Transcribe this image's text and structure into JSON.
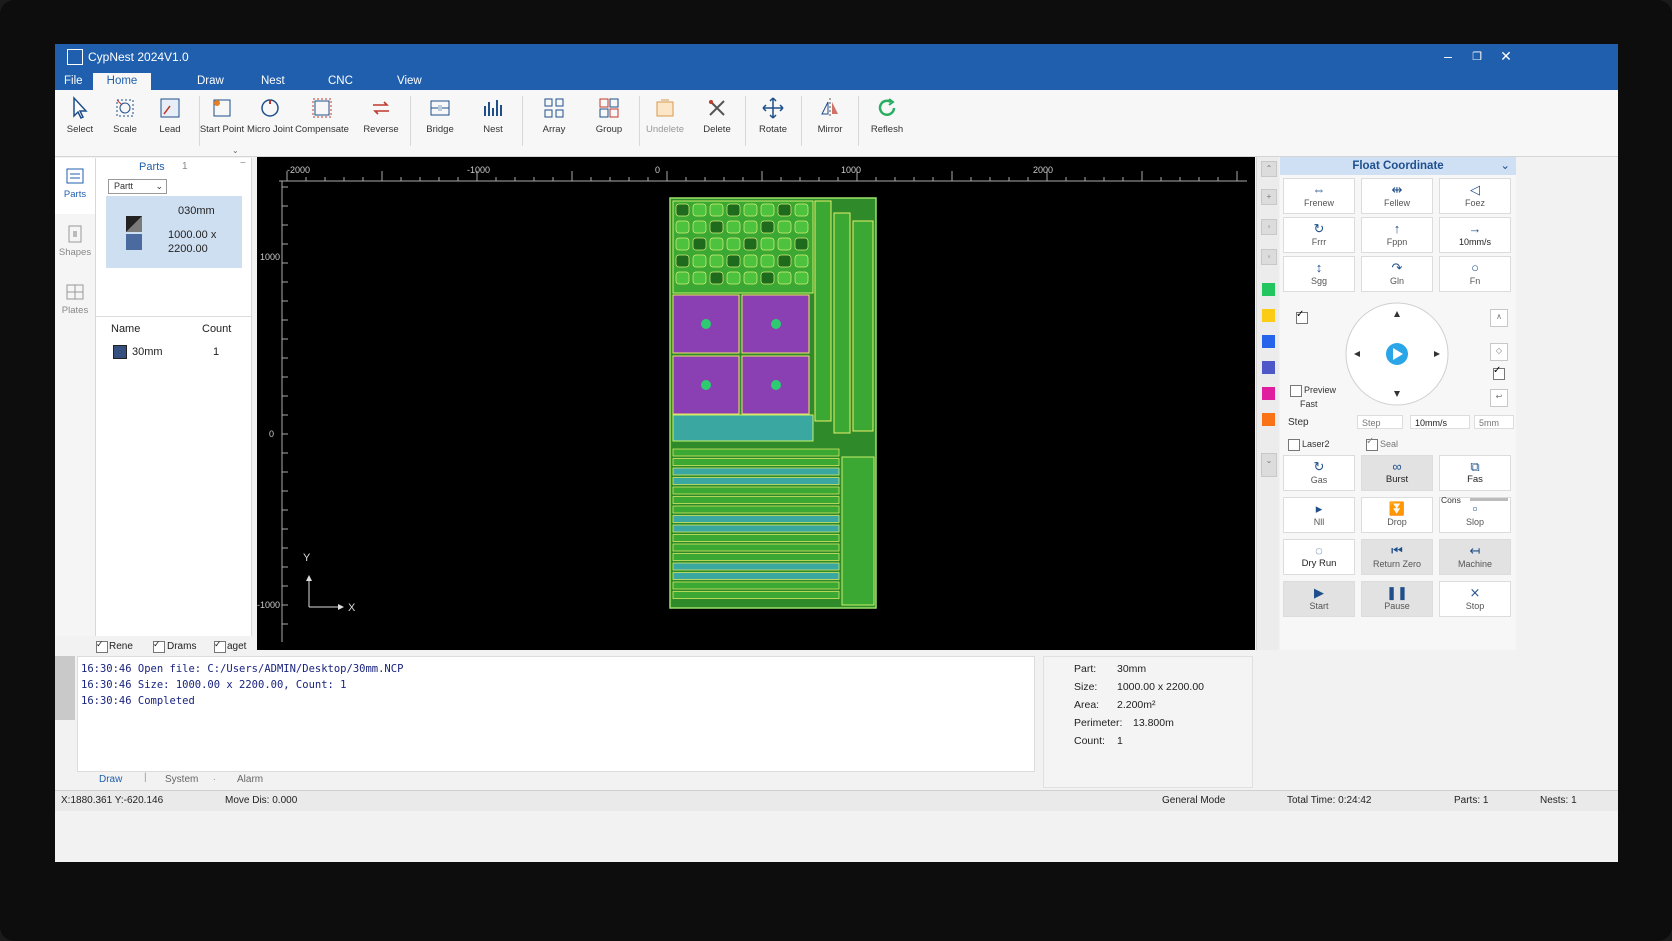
{
  "window": {
    "title": "CypNest 2024V1.0"
  },
  "menu": {
    "tabs": [
      "File",
      "Home",
      "Draw",
      "Nest",
      "CNC",
      "View"
    ],
    "active": "Home"
  },
  "ribbon": {
    "buttons": [
      {
        "label": "Select",
        "icon": "cursor-icon"
      },
      {
        "label": "Scale",
        "icon": "scale-icon"
      },
      {
        "label": "Lead",
        "icon": "lead-icon"
      },
      {
        "label": "Start Point",
        "icon": "start-point-icon"
      },
      {
        "label": "Micro Joint",
        "icon": "micro-joint-icon"
      },
      {
        "label": "Compensate",
        "icon": "compensate-icon"
      },
      {
        "label": "Reverse",
        "icon": "reverse-icon"
      },
      {
        "label": "Bridge",
        "icon": "bridge-icon"
      },
      {
        "label": "Nest",
        "icon": "nest-icon"
      },
      {
        "label": "Array",
        "icon": "array-icon"
      },
      {
        "label": "Group",
        "icon": "group-icon"
      },
      {
        "label": "Undelete",
        "icon": "undelete-icon"
      },
      {
        "label": "Delete",
        "icon": "delete-icon"
      },
      {
        "label": "Rotate",
        "icon": "rotate-icon"
      },
      {
        "label": "Mirror",
        "icon": "mirror-icon"
      },
      {
        "label": "Reflesh",
        "icon": "refresh-icon"
      }
    ]
  },
  "lefttabs": [
    {
      "label": "Parts"
    },
    {
      "label": "Shapes"
    },
    {
      "label": "Plates"
    }
  ],
  "parts": {
    "header": "Parts",
    "count": "1",
    "filter": "Partt",
    "card": {
      "name": "030mm",
      "size_line1": "1000.00 x",
      "size_line2": "2200.00"
    },
    "list": {
      "col_name": "Name",
      "col_count": "Count",
      "rows": [
        {
          "name": "30mm",
          "count": "1"
        }
      ]
    }
  },
  "filters": {
    "a": "Rene",
    "b": "Drams",
    "c": "aget"
  },
  "ruler": {
    "x_ticks": [
      "-2000",
      "-1000",
      "0",
      "1000",
      "2000"
    ],
    "y_ticks": [
      "1000",
      "0",
      "-1000"
    ],
    "axis_x": "X",
    "axis_y": "Y"
  },
  "control": {
    "title": "Float Coordinate",
    "top_buttons": [
      "Frenew",
      "Fellew",
      "Foez"
    ],
    "row2": [
      "Frrr",
      "Fppn",
      "10mm/s"
    ],
    "row3": [
      "Sgg",
      "Gln",
      "Fn"
    ],
    "preview": "Preview",
    "fast": "Fast",
    "step_label": "Step",
    "step_combo": "Step",
    "speed_field": "10mm/s",
    "dist_field": "5mm",
    "laser2": "Laser2",
    "seal": "Seal",
    "grid": [
      {
        "label": "Gas",
        "dark": false
      },
      {
        "label": "Burst",
        "dark": true
      },
      {
        "label": "Fas",
        "dark": false
      },
      {
        "label": "Nll",
        "dark": false
      },
      {
        "label": "Drop",
        "dark": false
      },
      {
        "label": "Slop",
        "dark": false
      },
      {
        "label": "Dry Run",
        "dark": false
      },
      {
        "label": "Return Zero",
        "dark": true
      },
      {
        "label": "Machine",
        "dark": true
      },
      {
        "label": "Start",
        "dark": true
      },
      {
        "label": "Pause",
        "dark": true
      },
      {
        "label": "Stop",
        "dark": false
      }
    ],
    "cons": "Cons"
  },
  "colors": {
    "swatches": [
      "#22c55e",
      "#facc15",
      "#2563eb",
      "#4f58c8",
      "#e11d9f",
      "#f97316"
    ],
    "accent": "#1f5fae"
  },
  "log": {
    "lines": [
      "16:30:46 Open file: C:/Users/ADMIN/Desktop/30mm.NCP",
      "16:30:46 Size: 1000.00 x 2200.00, Count: 1",
      "16:30:46 Completed"
    ],
    "tabs": [
      "Draw",
      "System",
      "Alarm"
    ]
  },
  "info": {
    "part_label": "Part:",
    "part": "30mm",
    "size_label": "Size:",
    "size": "1000.00 x 2200.00",
    "area_label": "Area:",
    "area": "2.200m²",
    "perimeter_label": "Perimeter:",
    "perimeter": "13.800m",
    "count_label": "Count:",
    "count": "1"
  },
  "status": {
    "coords": "X:1880.361 Y:-620.146",
    "move": "Move Dis: 0.000",
    "mode": "General Mode",
    "time": "Total Time: 0:24:42",
    "parts": "Parts: 1",
    "nests": "Nests: 1"
  }
}
